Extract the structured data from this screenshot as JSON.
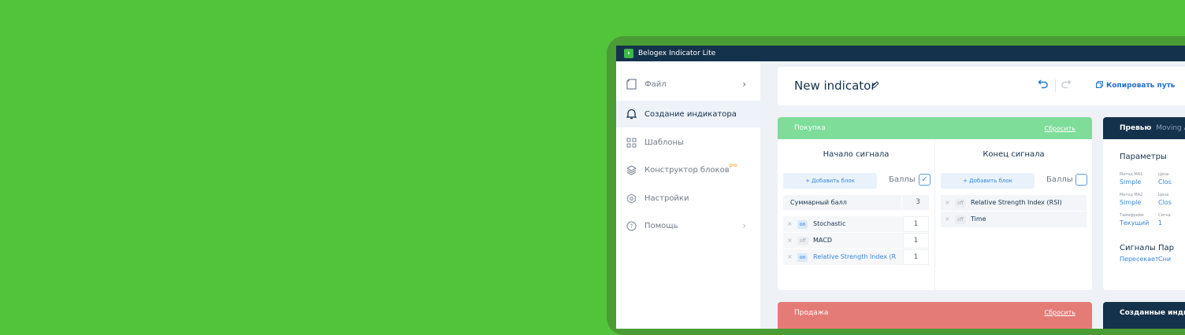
{
  "app": {
    "title": "Belogex Indicator Lite",
    "logo_glyph": "›"
  },
  "sidebar": {
    "items": [
      {
        "label": "Файл",
        "icon": "file-icon",
        "chevron": "›"
      },
      {
        "label": "Создание индикатора",
        "icon": "bell-icon",
        "active": true
      },
      {
        "label": "Шаблоны",
        "icon": "grid-icon"
      },
      {
        "label": "Конструктор блоков",
        "icon": "layers-icon",
        "badge": "pro"
      },
      {
        "label": "Настройки",
        "icon": "gear-icon"
      },
      {
        "label": "Помощь",
        "icon": "help-icon",
        "chevron": "›"
      }
    ]
  },
  "header": {
    "title": "New indicator",
    "edit_icon": "pencil-icon",
    "copy_label": "Копировать путь"
  },
  "buy": {
    "title": "Покупка",
    "reset": "Сбросить",
    "start": {
      "title": "Начало сигнала",
      "add_label": "+ Добавить блок",
      "score_label": "Баллы",
      "score_checked": true,
      "sum_label": "Суммарный балл",
      "sum_value": "3",
      "rules": [
        {
          "state": "on",
          "name": "Stochastic",
          "value": "1"
        },
        {
          "state": "off",
          "name": "MACD",
          "value": "1"
        },
        {
          "state": "on",
          "name": "Relative Strength Index (R",
          "value": "1"
        }
      ]
    },
    "end": {
      "title": "Конец сигнала",
      "add_label": "+ Добавить блок",
      "score_label": "Баллы",
      "score_checked": false,
      "rules": [
        {
          "state": "off",
          "name": "Relative Strength Index (RSI)"
        },
        {
          "state": "off",
          "name": "Time"
        }
      ]
    }
  },
  "preview": {
    "title": "Превью",
    "subtitle": "Moving A",
    "params_title": "Параметры",
    "params": [
      {
        "label": "Метод MA1",
        "value": "Simple"
      },
      {
        "label": "Цена",
        "value": "Clos"
      },
      {
        "label": "Метод MA2",
        "value": "Simple"
      },
      {
        "label": "Цена",
        "value": "Clos"
      },
      {
        "label": "Таймфрейм",
        "value": "Текущий"
      },
      {
        "label": "Сигна",
        "value": "1"
      }
    ],
    "signals_title": "Сигналы",
    "signals_value": "Пересекает",
    "pairs_title": "Пар",
    "pairs_value": "Сни"
  },
  "sell": {
    "title": "Продажа",
    "reset": "Сбросить"
  },
  "created": {
    "title": "Созданные инди"
  },
  "colors": {
    "background": "#52c43a",
    "navy": "#15324c",
    "buy": "#7ddd99",
    "sell": "#e57b76",
    "accent": "#1f6fd1"
  }
}
